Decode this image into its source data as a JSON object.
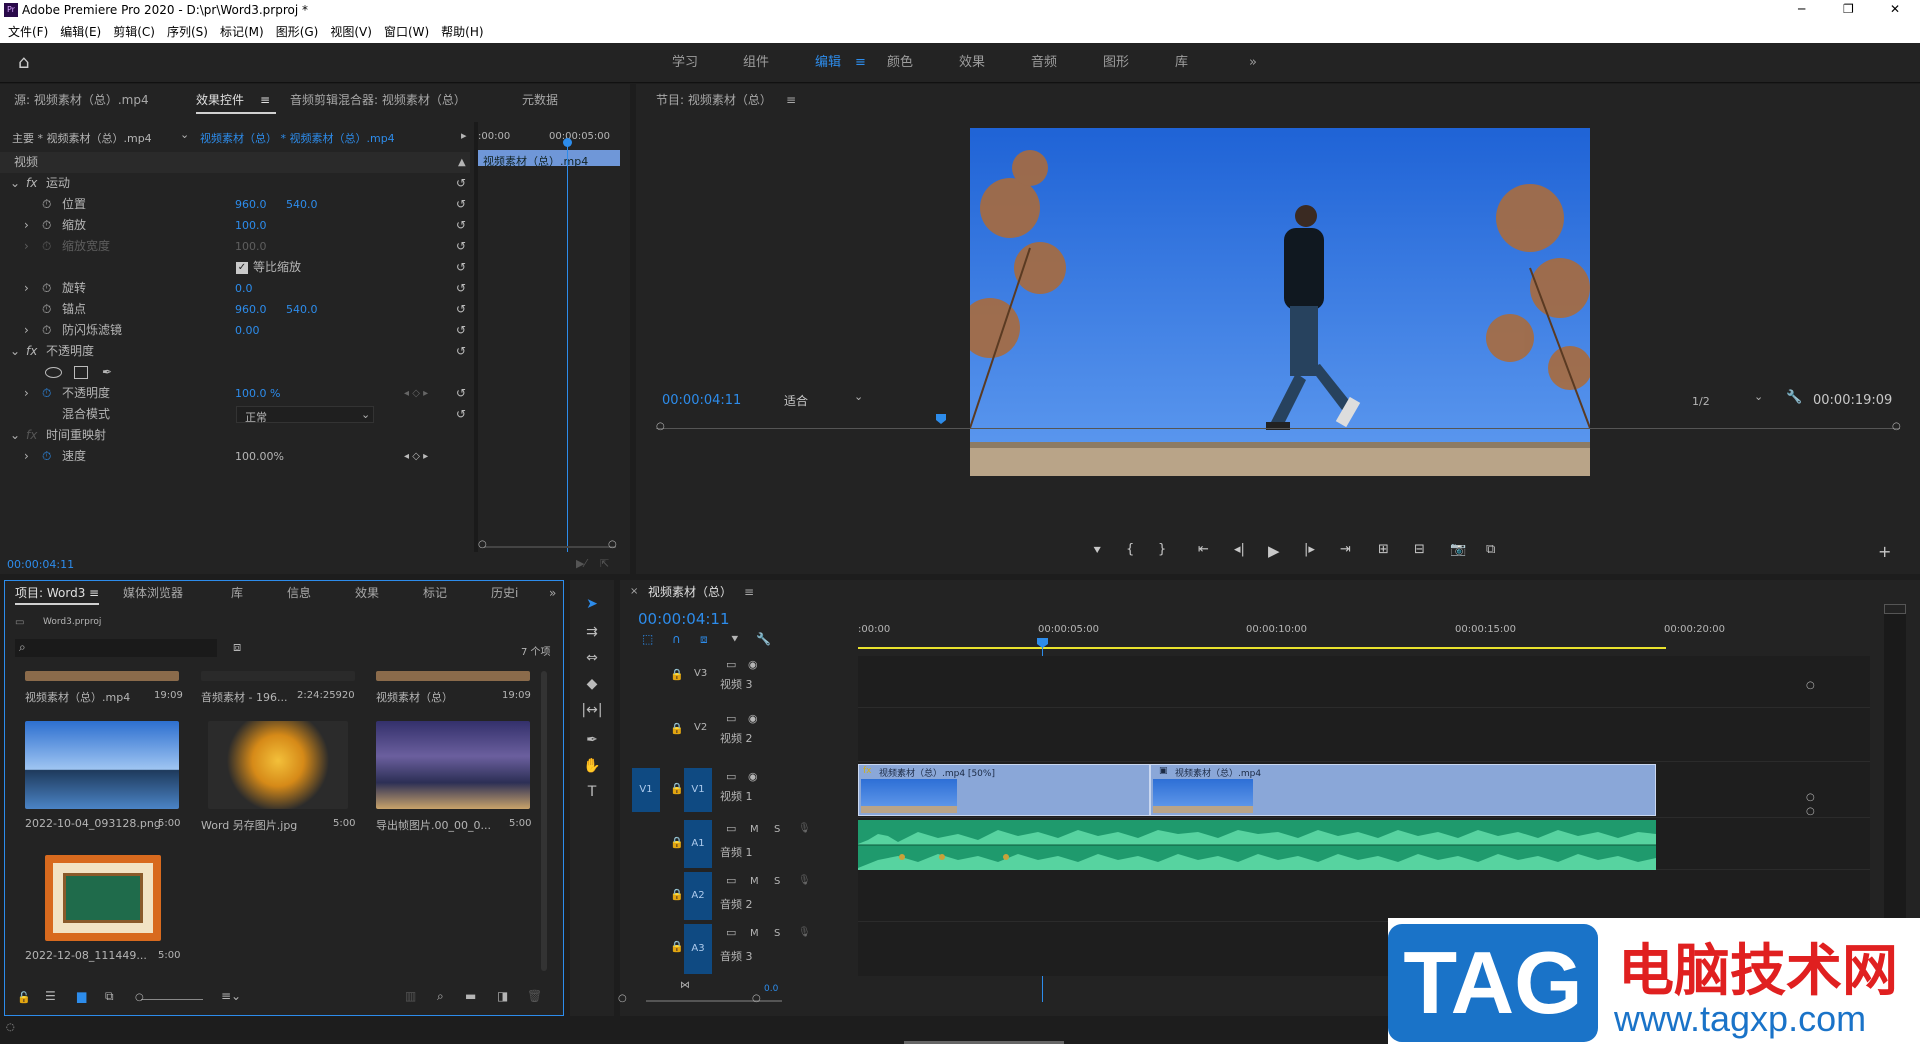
{
  "window": {
    "title": "Adobe Premiere Pro 2020 - D:\\pr\\Word3.prproj *",
    "minimize": "─",
    "maximize": "❐",
    "close": "✕"
  },
  "menu": [
    "文件(F)",
    "编辑(E)",
    "剪辑(C)",
    "序列(S)",
    "标记(M)",
    "图形(G)",
    "视图(V)",
    "窗口(W)",
    "帮助(H)"
  ],
  "workspaces": {
    "items": [
      "学习",
      "组件",
      "编辑",
      "颜色",
      "效果",
      "音频",
      "图形",
      "库"
    ],
    "active": "编辑",
    "more": "»"
  },
  "effect_controls": {
    "tabs": [
      "源: 视频素材（总）.mp4",
      "效果控件",
      "音频剪辑混合器: 视频素材（总）",
      "元数据"
    ],
    "active_tab": "效果控件",
    "master": "主要 * 视频素材（总）.mp4",
    "sequence_clip": "视频素材（总） * 视频素材（总）.mp4",
    "mini_time_start": ":00:00",
    "mini_time_end": "00:00:05:00",
    "mini_clip": "视频素材（总）.mp4",
    "section_video": "视频",
    "motion": "运动",
    "position_label": "位置",
    "position_x": "960.0",
    "position_y": "540.0",
    "scale_label": "缩放",
    "scale_value": "100.0",
    "scale_width_label": "缩放宽度",
    "scale_width_value": "100.0",
    "uniform_scale_label": "等比缩放",
    "rotation_label": "旋转",
    "rotation_value": "0.0",
    "anchor_label": "锚点",
    "anchor_x": "960.0",
    "anchor_y": "540.0",
    "flicker_label": "防闪烁滤镜",
    "flicker_value": "0.00",
    "opacity_section": "不透明度",
    "opacity_label": "不透明度",
    "opacity_value": "100.0 %",
    "blend_label": "混合模式",
    "blend_value": "正常",
    "time_remap": "时间重映射",
    "speed_label": "速度",
    "speed_value": "100.00%",
    "timecode": "00:00:04:11"
  },
  "program": {
    "title": "节目: 视频素材（总）",
    "timecode": "00:00:04:11",
    "fit": "适合",
    "resolution": "1/2",
    "duration": "00:00:19:09"
  },
  "project": {
    "tabs": [
      "项目: Word3",
      "媒体浏览器",
      "库",
      "信息",
      "效果",
      "标记",
      "历史i"
    ],
    "file": "Word3.prproj",
    "count": "7 个项",
    "items": [
      {
        "name": "视频素材（总）.mp4",
        "dur": "19:09"
      },
      {
        "name": "音频素材 - 196...",
        "dur": "2:24:25920"
      },
      {
        "name": "视频素材（总）",
        "dur": "19:09"
      },
      {
        "name": "2022-10-04_093128.png",
        "dur": "5:00"
      },
      {
        "name": "Word 另存图片.jpg",
        "dur": "5:00"
      },
      {
        "name": "导出帧图片.00_00_0...",
        "dur": "5:00"
      },
      {
        "name": "2022-12-08_111449...",
        "dur": "5:00"
      }
    ]
  },
  "timeline": {
    "title": "视频素材（总）",
    "timecode": "00:00:04:11",
    "ruler": [
      ":00:00",
      "00:00:05:00",
      "00:00:10:00",
      "00:00:15:00",
      "00:00:20:00"
    ],
    "tracks": {
      "v3": "V3",
      "v2": "V2",
      "v1": "V1",
      "a1": "A1",
      "a2": "A2",
      "a3": "A3"
    },
    "track_names": {
      "v3": "视频 3",
      "v2": "视频 2",
      "v1": "视频 1",
      "a1": "音频 1",
      "a2": "音频 2",
      "a3": "音频 3"
    },
    "clip1": "视频素材（总）.mp4 [50%]",
    "clip2": "视频素材（总）.mp4",
    "mute": "M",
    "solo": "S",
    "footer_val": "0.0"
  },
  "watermark": {
    "tag": "TAG",
    "cn": "电脑技术网",
    "url": "www.tagxp.com"
  }
}
